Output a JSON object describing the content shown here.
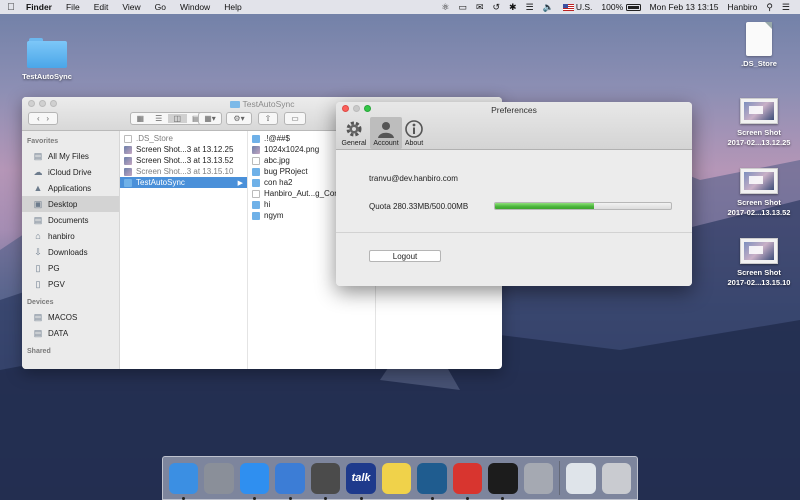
{
  "menubar": {
    "apple": "",
    "app_name": "Finder",
    "menus": [
      "File",
      "Edit",
      "View",
      "Go",
      "Window",
      "Help"
    ],
    "input_source": "U.S.",
    "battery": "100%",
    "datetime": "Mon Feb 13  13:15",
    "user": "Hanbiro"
  },
  "desktop": {
    "folder_label": "TestAutoSync",
    "ds_store_label": ".DS_Store",
    "screenshots": [
      {
        "line1": "Screen Shot",
        "line2": "2017-02...13.12.25"
      },
      {
        "line1": "Screen Shot",
        "line2": "2017-02...13.13.52"
      },
      {
        "line1": "Screen Shot",
        "line2": "2017-02...13.15.10"
      }
    ]
  },
  "finder": {
    "title": "TestAutoSync",
    "sidebar": {
      "favorites_header": "Favorites",
      "favorites": [
        {
          "label": "All My Files",
          "icon": "all-files-icon"
        },
        {
          "label": "iCloud Drive",
          "icon": "cloud-icon"
        },
        {
          "label": "Applications",
          "icon": "applications-icon"
        },
        {
          "label": "Desktop",
          "icon": "desktop-icon",
          "selected": true
        },
        {
          "label": "Documents",
          "icon": "documents-icon"
        },
        {
          "label": "hanbiro",
          "icon": "home-icon"
        },
        {
          "label": "Downloads",
          "icon": "downloads-icon"
        },
        {
          "label": "PG",
          "icon": "folder-icon"
        },
        {
          "label": "PGV",
          "icon": "folder-icon"
        }
      ],
      "devices_header": "Devices",
      "devices": [
        {
          "label": "MACOS",
          "icon": "disk-icon"
        },
        {
          "label": "DATA",
          "icon": "disk-icon"
        }
      ],
      "shared_header": "Shared"
    },
    "column1": [
      {
        "name": ".DS_Store",
        "kind": "file",
        "dim": true
      },
      {
        "name": "Screen Shot...3 at 13.12.25",
        "kind": "img"
      },
      {
        "name": "Screen Shot...3 at 13.13.52",
        "kind": "img"
      },
      {
        "name": "Screen Shot...3 at 13.15.10",
        "kind": "img",
        "dim": true
      },
      {
        "name": "TestAutoSync",
        "kind": "folder",
        "selected": true
      }
    ],
    "column2": [
      {
        "name": ".!@##$",
        "kind": "folder"
      },
      {
        "name": "1024x1024.png",
        "kind": "img"
      },
      {
        "name": "abc.jpg",
        "kind": "file"
      },
      {
        "name": "bug PRoject",
        "kind": "folder"
      },
      {
        "name": "con ha2",
        "kind": "folder"
      },
      {
        "name": "Hanbiro_Aut...g_Cor",
        "kind": "file"
      },
      {
        "name": "hi",
        "kind": "folder"
      },
      {
        "name": "ngym",
        "kind": "folder"
      }
    ]
  },
  "prefs": {
    "title": "Preferences",
    "tabs": [
      {
        "label": "General",
        "icon": "gear-icon"
      },
      {
        "label": "Account",
        "icon": "person-icon",
        "selected": true
      },
      {
        "label": "About",
        "icon": "info-icon"
      }
    ],
    "email": "tranvu@dev.hanbiro.com",
    "quota_label": "Quota 280.33MB/500.00MB",
    "quota_fraction": 0.56,
    "logout_label": "Logout"
  },
  "dock": {
    "apps": [
      {
        "name": "finder-icon",
        "color": "#3b8fe3",
        "running": true
      },
      {
        "name": "launchpad-icon",
        "color": "#8a8f99"
      },
      {
        "name": "safari-icon",
        "color": "#2f8ff0",
        "running": true
      },
      {
        "name": "xcode-icon",
        "color": "#3c7dd6",
        "running": true
      },
      {
        "name": "sublime-icon",
        "color": "#4b4b4b",
        "running": true
      },
      {
        "name": "talk-icon",
        "color": "#1e3a8c",
        "text": "talk",
        "running": true
      },
      {
        "name": "stickies-icon",
        "color": "#f0d24a"
      },
      {
        "name": "sourcetree-icon",
        "color": "#1f5c8f",
        "running": true
      },
      {
        "name": "cplus-icon",
        "color": "#d8352f",
        "running": true
      },
      {
        "name": "terminal-icon",
        "color": "#1c1c1c",
        "running": true
      },
      {
        "name": "keychain-icon",
        "color": "#a5a9b2"
      },
      {
        "name": "preview-icon",
        "color": "#dfe4ea"
      },
      {
        "name": "trash-icon",
        "color": "#c9cbd0"
      }
    ]
  },
  "colors": {
    "accent": "#4a90d9",
    "progress": "#49b43a"
  }
}
